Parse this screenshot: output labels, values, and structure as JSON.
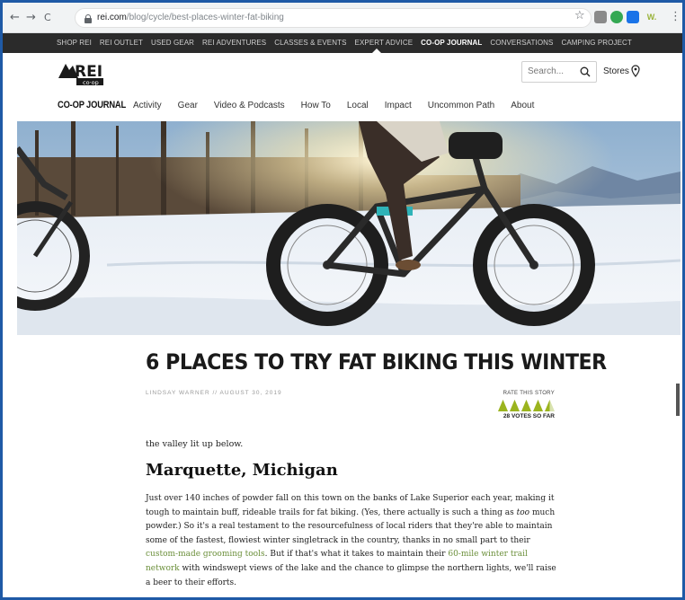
{
  "browser": {
    "url_host": "rei.com",
    "url_path": "/blog/cycle/best-places-winter-fat-biking",
    "back_glyph": "←",
    "forward_glyph": "→",
    "reload_glyph": "C",
    "star_glyph": "☆",
    "menu_glyph": "⋮",
    "extensions": [
      {
        "name": "ext-grey-icon",
        "label": "",
        "color": "#8a8a8a"
      },
      {
        "name": "ext-green-icon",
        "label": "",
        "color": "#34a853"
      },
      {
        "name": "ext-blue-icon",
        "label": "",
        "color": "#1a73e8"
      },
      {
        "name": "ext-w-icon",
        "label": "W.",
        "color": "#9ab33a"
      }
    ]
  },
  "topbar": {
    "items": [
      {
        "label": "SHOP REI",
        "active": false
      },
      {
        "label": "REI OUTLET",
        "active": false
      },
      {
        "label": "USED GEAR",
        "active": false
      },
      {
        "label": "REI ADVENTURES",
        "active": false
      },
      {
        "label": "CLASSES & EVENTS",
        "active": false
      },
      {
        "label": "EXPERT ADVICE",
        "active": false
      },
      {
        "label": "CO-OP JOURNAL",
        "active": true
      },
      {
        "label": "CONVERSATIONS",
        "active": false
      },
      {
        "label": "CAMPING PROJECT",
        "active": false
      }
    ]
  },
  "header": {
    "logo_text": "REI",
    "logo_sub": "co·op",
    "search_placeholder": "Search...",
    "stores_label": "Stores"
  },
  "journal_nav": {
    "brand": "CO-OP JOURNAL",
    "items": [
      "Activity",
      "Gear",
      "Video & Podcasts",
      "How To",
      "Local",
      "Impact",
      "Uncommon Path",
      "About"
    ]
  },
  "article": {
    "title": "6 PLACES TO TRY FAT BIKING THIS WINTER",
    "byline": "LINDSAY WARNER // AUGUST 30, 2019",
    "rate_label": "RATE THIS STORY",
    "rating": 4.5,
    "rating_max": 5,
    "votes": "28 VOTES SO FAR",
    "intro_tail": "the valley lit up below.",
    "section_heading": "Marquette, Michigan",
    "body_1": "Just over 140 inches of powder fall on this town on the banks of Lake Superior each year, making it tough to maintain buff, rideable trails for fat biking. (Yes, there actually is such a thing as ",
    "body_em": "too",
    "body_2": " much powder.) So it's a real testament to the resourcefulness of local riders that they're able to maintain some of the fastest, flowiest winter singletrack in the country, thanks in no small part to their ",
    "link_1": "custom-made grooming tools",
    "body_3": ". But if that's what it takes to maintain their ",
    "link_2": "60-mile winter trail network",
    "body_4": " with windswept views of the lake and the chance to glimpse the northern lights, we'll raise a beer to their efforts.",
    "tree_color": "#9bb41e"
  }
}
